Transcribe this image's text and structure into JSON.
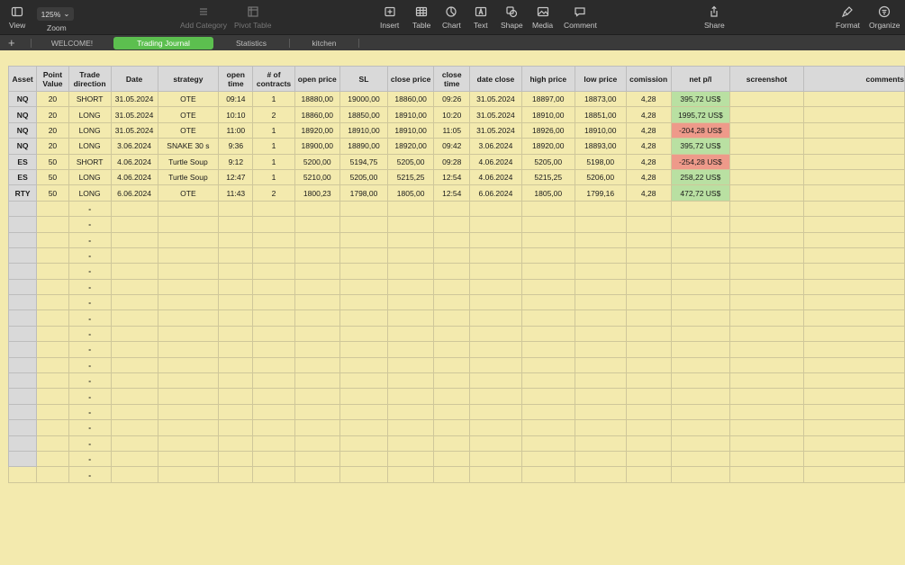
{
  "toolbar": {
    "view": "View",
    "zoom_value": "125%",
    "zoom": "Zoom",
    "add_category": "Add Category",
    "pivot_table": "Pivot Table",
    "insert": "Insert",
    "table": "Table",
    "chart": "Chart",
    "text": "Text",
    "shape": "Shape",
    "media": "Media",
    "comment": "Comment",
    "share": "Share",
    "format": "Format",
    "organize": "Organize"
  },
  "tabs": {
    "add": "+",
    "items": [
      {
        "label": "WELCOME!"
      },
      {
        "label": "Trading Journal"
      },
      {
        "label": "Statistics"
      },
      {
        "label": "kitchen"
      }
    ]
  },
  "columns": [
    "Asset",
    "Point Value",
    "Trade direction",
    "Date",
    "strategy",
    "open time",
    "# of contracts",
    "open price",
    "SL",
    "close price",
    "close time",
    "date close",
    "high price",
    "low price",
    "comission",
    "net p/l",
    "screenshot",
    "comments"
  ],
  "rows": [
    [
      "NQ",
      "20",
      "SHORT",
      "31.05.2024",
      "OTE",
      "09:14",
      "1",
      "18880,00",
      "19000,00",
      "18860,00",
      "09:26",
      "31.05.2024",
      "18897,00",
      "18873,00",
      "4,28",
      "395,72 US$",
      "",
      ""
    ],
    [
      "NQ",
      "20",
      "LONG",
      "31.05.2024",
      "OTE",
      "10:10",
      "2",
      "18860,00",
      "18850,00",
      "18910,00",
      "10:20",
      "31.05.2024",
      "18910,00",
      "18851,00",
      "4,28",
      "1995,72 US$",
      "",
      ""
    ],
    [
      "NQ",
      "20",
      "LONG",
      "31.05.2024",
      "OTE",
      "11:00",
      "1",
      "18920,00",
      "18910,00",
      "18910,00",
      "11:05",
      "31.05.2024",
      "18926,00",
      "18910,00",
      "4,28",
      "-204,28 US$",
      "",
      ""
    ],
    [
      "NQ",
      "20",
      "LONG",
      "3.06.2024",
      "SNAKE 30 s",
      "9:36",
      "1",
      "18900,00",
      "18890,00",
      "18920,00",
      "09:42",
      "3.06.2024",
      "18920,00",
      "18893,00",
      "4,28",
      "395,72 US$",
      "",
      ""
    ],
    [
      "ES",
      "50",
      "SHORT",
      "4.06.2024",
      "Turtle Soup",
      "9:12",
      "1",
      "5200,00",
      "5194,75",
      "5205,00",
      "09:28",
      "4.06.2024",
      "5205,00",
      "5198,00",
      "4,28",
      "-254,28 US$",
      "",
      ""
    ],
    [
      "ES",
      "50",
      "LONG",
      "4.06.2024",
      "Turtle Soup",
      "12:47",
      "1",
      "5210,00",
      "5205,00",
      "5215,25",
      "12:54",
      "4.06.2024",
      "5215,25",
      "5206,00",
      "4,28",
      "258,22 US$",
      "",
      ""
    ],
    [
      "RTY",
      "50",
      "LONG",
      "6.06.2024",
      "OTE",
      "11:43",
      "2",
      "1800,23",
      "1798,00",
      "1805,00",
      "12:54",
      "6.06.2024",
      "1805,00",
      "1799,16",
      "4,28",
      "472,72 US$",
      "",
      ""
    ]
  ],
  "pnl_status": [
    "positive",
    "positive",
    "negative",
    "positive",
    "negative",
    "positive",
    "positive"
  ],
  "colors": {
    "positive": "#b9e0a2",
    "negative": "#ee9a8a",
    "active_tab": "#5cbf4f",
    "sheet_bg": "#f3eaae"
  },
  "empty_row_placeholder": "-",
  "empty_row_count": 17,
  "footer_placeholder": "-"
}
